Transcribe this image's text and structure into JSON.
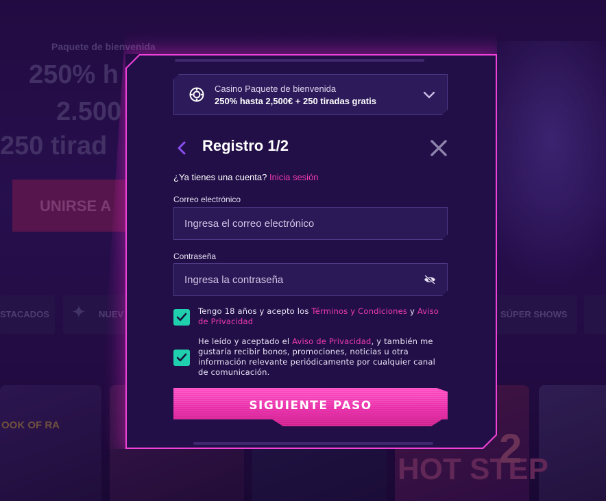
{
  "background": {
    "promo_subtitle": "Paquete de bienvenida",
    "promo_line1": "250% h",
    "promo_line2": "2.500",
    "promo_line3": "250 tirad",
    "join_button": "UNIRSE A",
    "categories": [
      "STACADOS",
      "NUEV",
      "SÚPER SHOWS"
    ],
    "game_texts": [
      "OOK OF RA",
      "HOT STEP",
      "2"
    ]
  },
  "bonus_selector": {
    "icon": "casino-chip-icon",
    "line1": "Casino Paquete de bienvenida",
    "line2": "250% hasta 2,500€ + 250 tiradas gratis",
    "chevron": "chevron-down-icon"
  },
  "header": {
    "back_icon": "chevron-left-icon",
    "title": "Registro 1/2",
    "close_icon": "close-icon"
  },
  "login_prompt": {
    "text": "¿Ya tienes una cuenta?",
    "link": "Inicia sesión"
  },
  "email": {
    "label": "Correo electrónico",
    "placeholder": "Ingresa el correo electrónico",
    "value": ""
  },
  "password": {
    "label": "Contraseña",
    "placeholder": "Ingresa la contraseña",
    "value": "",
    "toggle_icon": "eye-slash-icon"
  },
  "consent_terms": {
    "checked": true,
    "text_before": "Tengo 18 años y acepto los ",
    "link1": "Términos y Condiciones",
    "text_mid": " y ",
    "link2": "Aviso de Privacidad"
  },
  "consent_marketing": {
    "checked": true,
    "text_before": "He leído y aceptado el ",
    "link": "Aviso de Privacidad",
    "text_after": ", y también me gustaría recibir bonos, promociones, noticias u otra información relevante periódicamente por cualquier canal de comunicación."
  },
  "next_button": {
    "label": "SIGUIENTE PASO"
  },
  "colors": {
    "accent_pink": "#f13bb0",
    "modal_border": "#ef42d8",
    "modal_bg": "#220f48",
    "checkbox_teal": "#1fcfae",
    "field_bg": "#2b1856"
  }
}
